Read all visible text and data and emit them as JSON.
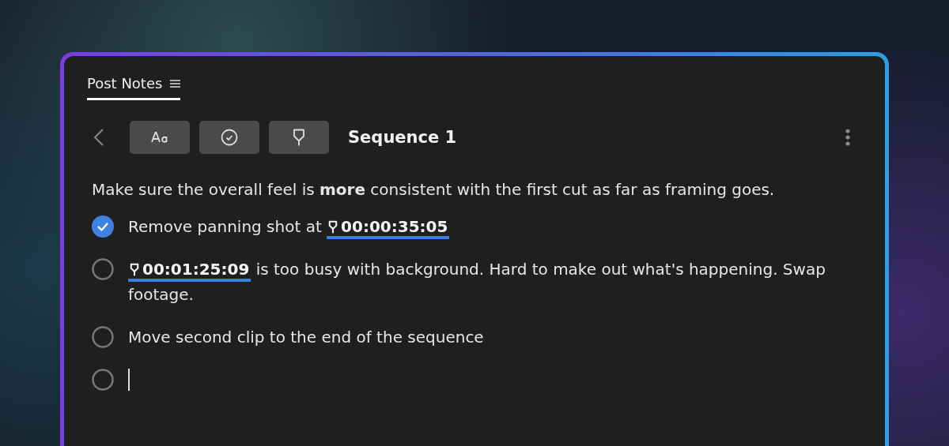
{
  "panel": {
    "tab": {
      "label": "Post Notes",
      "selected": true
    }
  },
  "toolbar": {
    "title": "Sequence 1"
  },
  "note": "Make sure the overall feel is **more** consistent with the first cut as far as framing goes.",
  "tasks": [
    {
      "kind": "task",
      "checked": true,
      "parts": [
        {
          "kind": "text",
          "text": "Remove panning shot at "
        },
        {
          "kind": "marker",
          "text": "00:00:35:05"
        }
      ]
    },
    {
      "kind": "task",
      "checked": false,
      "parts": [
        {
          "kind": "marker",
          "text": "00:01:25:09"
        },
        {
          "kind": "text",
          "text": " is too busy with background. Hard to make out what's happening. Swap footage."
        }
      ]
    },
    {
      "kind": "task",
      "checked": false,
      "parts": [
        {
          "kind": "text",
          "text": "Move second clip to the end of the sequence"
        }
      ]
    },
    {
      "kind": "editing",
      "checked": false
    }
  ]
}
